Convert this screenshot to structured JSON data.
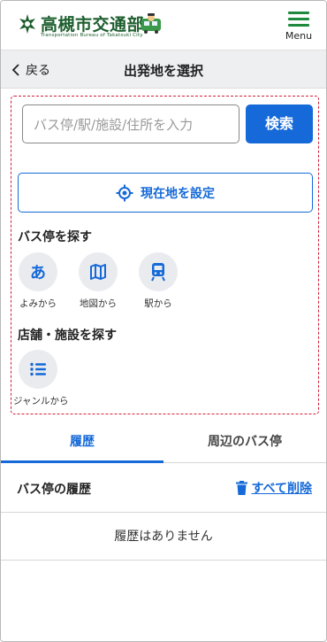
{
  "header": {
    "logo_title": "高槻市交通部",
    "logo_subtitle": "Transportation Bureau of Takatsuki City",
    "menu_label": "Menu"
  },
  "navbar": {
    "back_label": "戻る",
    "title": "出発地を選択"
  },
  "search": {
    "placeholder": "バス停/駅/施設/住所を入力",
    "button_label": "検索"
  },
  "current_location": {
    "label": "現在地を設定"
  },
  "bus_stop_section": {
    "title": "バス停を探す",
    "items": [
      {
        "icon": "hiragana-a-icon",
        "glyph": "あ",
        "label": "よみから"
      },
      {
        "icon": "map-icon",
        "label": "地図から"
      },
      {
        "icon": "train-icon",
        "label": "駅から"
      }
    ]
  },
  "facility_section": {
    "title": "店舗・施設を探す",
    "items": [
      {
        "icon": "list-icon",
        "label": "ジャンルから"
      }
    ]
  },
  "tabs": [
    {
      "label": "履歴",
      "active": true
    },
    {
      "label": "周辺のバス停",
      "active": false
    }
  ],
  "history": {
    "title": "バス停の履歴",
    "delete_all_label": "すべて削除",
    "empty_message": "履歴はありません"
  },
  "colors": {
    "accent": "#1569d8",
    "brand_green": "#1f8a3e",
    "highlight_border": "#d0203a"
  }
}
